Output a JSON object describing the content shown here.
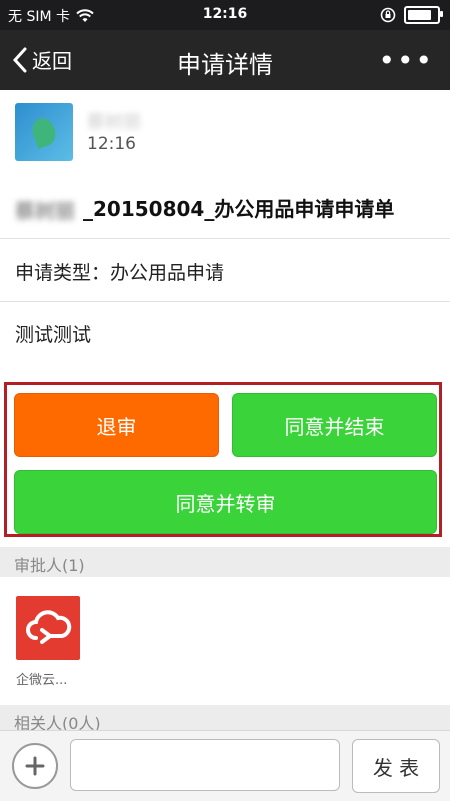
{
  "status_bar": {
    "carrier": "无 SIM 卡",
    "time": "12:16",
    "battery_level": 0.85
  },
  "nav": {
    "back_label": "返回",
    "title": "申请详情",
    "more_label": "•••"
  },
  "header": {
    "sender_name": "蔡树丽",
    "time": "12:16"
  },
  "request": {
    "title_blurred": "蔡树丽",
    "title": "_20150804_办公用品申请申请单",
    "type": "申请类型：办公用品申请",
    "description": "测试测试"
  },
  "actions": {
    "reject": "退审",
    "approve_end": "同意并结束",
    "approve_transfer": "同意并转审"
  },
  "approvers": {
    "header": "审批人(1)",
    "items": [
      {
        "name": "企微云..."
      }
    ]
  },
  "related": {
    "header": "相关人(0人)"
  },
  "input_bar": {
    "placeholder": "",
    "send_label": "发 表"
  },
  "colors": {
    "orange": "#ff6a00",
    "green": "#3ad33a",
    "highlight": "#b21f24",
    "nav_bg": "#262626"
  }
}
